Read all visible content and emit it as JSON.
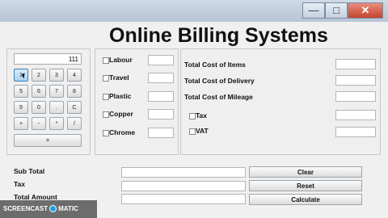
{
  "window": {
    "minimize": "—",
    "maximize": "□",
    "close": "✕"
  },
  "title": "Online Billing Systems",
  "calculator": {
    "display": "111",
    "keys": [
      "1",
      "2",
      "3",
      "4",
      "5",
      "6",
      "7",
      "8",
      "9",
      "0",
      ".",
      "C",
      "+",
      "-",
      "*",
      "/"
    ],
    "equals": "="
  },
  "materials": [
    "Labour",
    "Travel",
    "Plastic",
    "Copper",
    "Chrome"
  ],
  "costs": {
    "items": "Total Cost of Items",
    "delivery": "Total Cost of Delivery",
    "mileage": "Total Cost of Mileage",
    "tax": "Tax",
    "vat": "VAT"
  },
  "summary": {
    "subtotal": "Sub Total",
    "tax": "Tax",
    "total": "Total Amount"
  },
  "buttons": {
    "clear": "Clear",
    "reset": "Reset",
    "calculate": "Calculate"
  },
  "watermark": {
    "left": "SCREENCAST",
    "right": "MATIC"
  }
}
